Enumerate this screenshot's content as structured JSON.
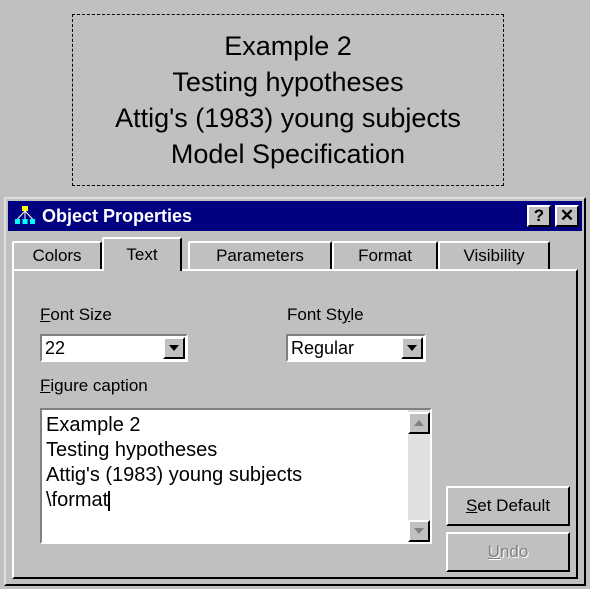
{
  "caption_preview": {
    "lines": [
      "Example 2",
      "Testing hypotheses",
      "Attig's (1983) young subjects",
      "Model Specification"
    ]
  },
  "window": {
    "title": "Object Properties",
    "help_label": "?",
    "close_label": "✕"
  },
  "tabs": [
    {
      "label": "Colors",
      "active": false
    },
    {
      "label": "Text",
      "active": true
    },
    {
      "label": "Parameters",
      "active": false
    },
    {
      "label": "Format",
      "active": false
    },
    {
      "label": "Visibility",
      "active": false
    }
  ],
  "font_size": {
    "label_mnemonic": "F",
    "label_rest": "ont Size",
    "value": "22"
  },
  "font_style": {
    "label_pre": "Font St",
    "label_mnemonic": "y",
    "label_post": "le",
    "value": "Regular"
  },
  "figure_caption": {
    "label_mnemonic": "F",
    "label_rest": "igure caption",
    "lines": [
      "Example 2",
      "Testing hypotheses",
      "Attig's (1983) young subjects",
      "\\format"
    ]
  },
  "buttons": {
    "set_default": {
      "mnemonic": "S",
      "rest": "et Default"
    },
    "undo": {
      "mnemonic": "U",
      "rest": "ndo"
    }
  },
  "colors": {
    "titlebar": "#000080",
    "face": "#c0c0c0"
  }
}
